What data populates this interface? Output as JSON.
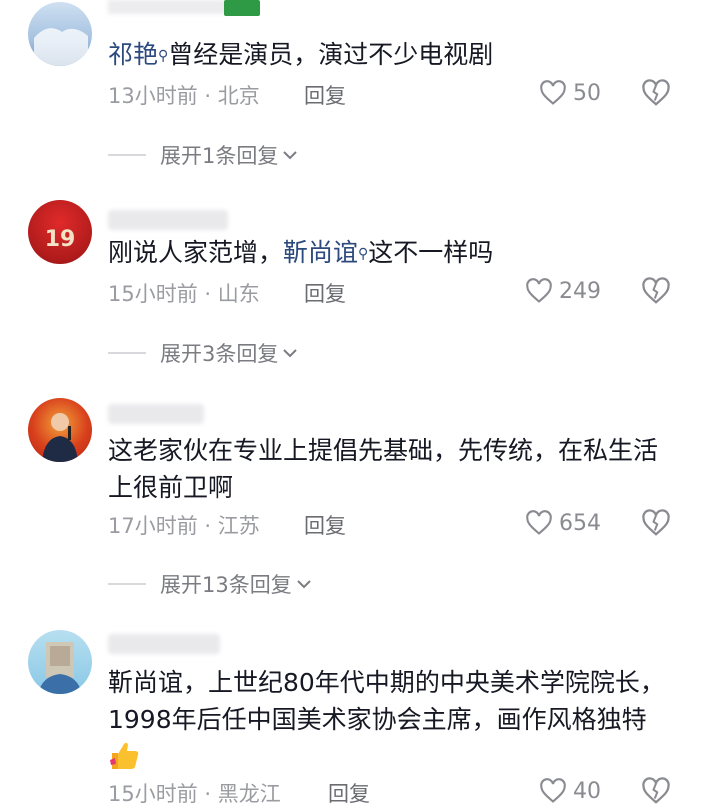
{
  "comments": [
    {
      "mention": "祁艳",
      "text": "曾经是演员，演过不少电视剧",
      "time_location": "13小时前 · 北京",
      "reply_label": "回复",
      "likes": "50",
      "expand_label": "展开1条回复"
    },
    {
      "text_before": "刚说人家范增，",
      "mention": "靳尚谊",
      "text_after": "这不一样吗",
      "time_location": "15小时前 · 山东",
      "reply_label": "回复",
      "likes": "249",
      "expand_label": "展开3条回复"
    },
    {
      "text": "这老家伙在专业上提倡先基础，先传统，在私生活上很前卫啊",
      "time_location": "17小时前 · 江苏",
      "reply_label": "回复",
      "likes": "654",
      "expand_label": "展开13条回复"
    },
    {
      "text": "靳尚谊，上世纪80年代中期的中央美术学院院长，1998年后任中国美术家协会主席，画作风格独特",
      "time_location": "15小时前 · 黑龙江",
      "reply_label": "回复",
      "likes": "40"
    }
  ],
  "colors": {
    "mention": "#2c4a7e",
    "meta": "#9b9ca1",
    "text": "#161823"
  },
  "icons": [
    "search-icon",
    "heart-icon",
    "broken-heart-icon",
    "chevron-down-icon",
    "thumbs-up-icon"
  ]
}
